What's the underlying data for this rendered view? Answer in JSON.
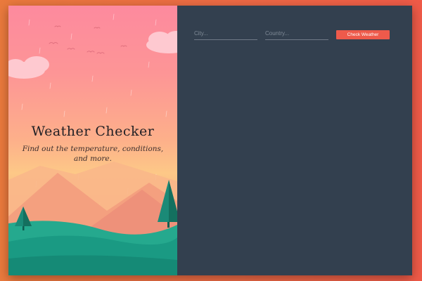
{
  "hero": {
    "title": "Weather Checker",
    "subtitle": "Find out the temperature, conditions, and more."
  },
  "form": {
    "city_placeholder": "City...",
    "country_placeholder": "Country...",
    "submit_label": "Check Weather"
  },
  "colors": {
    "page_background": "#ec6e43",
    "panel_dark": "#33404f",
    "accent_button": "#ee5a4b",
    "sky_top": "#fd8a9e",
    "sky_horizon": "#fdc887",
    "hills_teal": "#1fa089"
  }
}
